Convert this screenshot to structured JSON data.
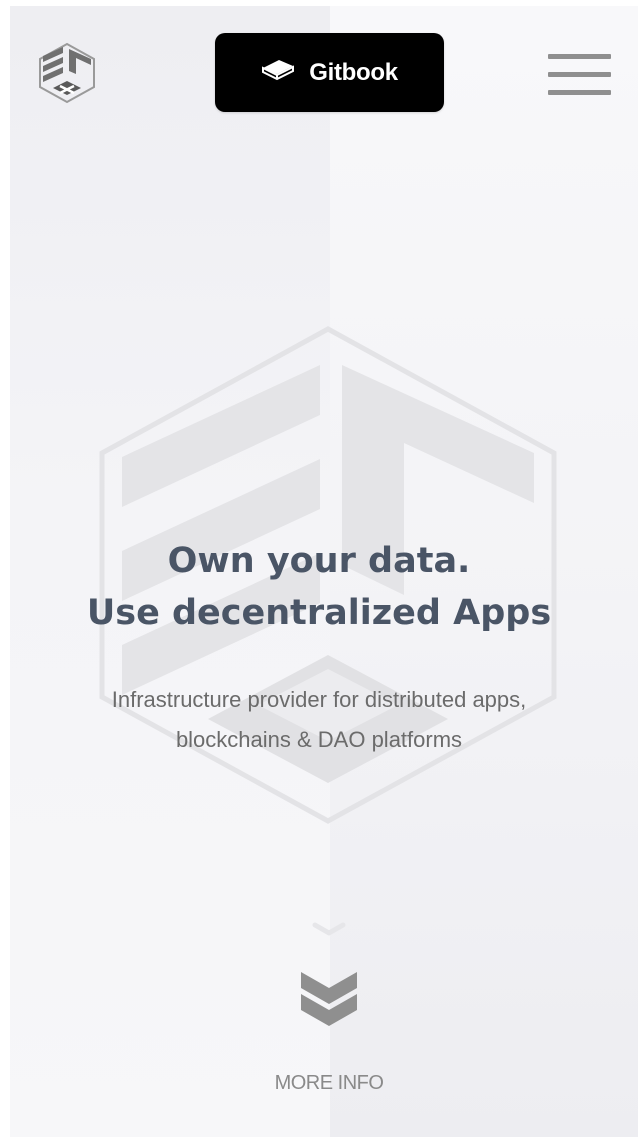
{
  "header": {
    "logo_icon": "efx-hexagon-logo-icon",
    "gitbook_button": {
      "label": "Gitbook",
      "icon": "book-icon"
    },
    "menu_icon": "hamburger-menu-icon"
  },
  "hero": {
    "emblem_icon": "efx-hexagon-emblem",
    "title_line_1": "Own your data.",
    "title_line_2": "Use decentralized Apps",
    "subtitle_line_1": "Infrastructure provider for distributed apps,",
    "subtitle_line_2": "blockchains & DAO platforms"
  },
  "scroll": {
    "small_chevron_icon": "chevron-down-icon",
    "double_chevron_icon": "double-chevron-down-icon",
    "more_info_label": "MORE INFO"
  },
  "colors": {
    "title": "#4a5566",
    "subtitle": "#6b6b6b",
    "button_bg": "#000000",
    "icon_gray": "#8f8f8f",
    "more_info": "#8a8a8a"
  }
}
